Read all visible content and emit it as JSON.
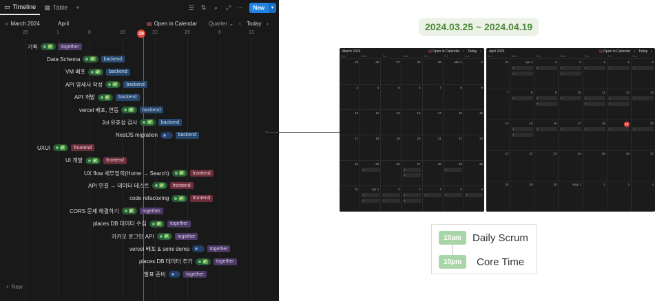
{
  "toolbar": {
    "tabs": [
      {
        "label": "Timeline",
        "icon": "timeline-icon"
      },
      {
        "label": "Table",
        "icon": "table-icon"
      }
    ],
    "add_view": "+",
    "new_label": "New"
  },
  "nav": {
    "month1": "March 2024",
    "month2": "April",
    "open_calendar": "Open in Calendar",
    "scale": "Quarter",
    "today": "Today"
  },
  "dates": [
    "25",
    "1",
    "8",
    "15",
    "19",
    "22",
    "29",
    "6",
    "13"
  ],
  "tasks": [
    {
      "name": "기획",
      "status": "done",
      "tag": "together"
    },
    {
      "name": "Data Schema",
      "status": "done",
      "tag": "backend"
    },
    {
      "name": "VM 배포",
      "status": "done",
      "tag": "backend"
    },
    {
      "name": "API 명세서 작성",
      "status": "done",
      "tag": "backend"
    },
    {
      "name": "API 개발",
      "status": "done",
      "tag": "backend"
    },
    {
      "name": "vercel 배포, 연동",
      "status": "done",
      "tag": "backend"
    },
    {
      "name": "Joi 유효성 검사",
      "status": "done",
      "tag": "backend"
    },
    {
      "name": "NestJS migration",
      "status": "prog",
      "tag": "backend"
    },
    {
      "name": "UXUI",
      "status": "done",
      "tag": "frontend"
    },
    {
      "name": "UI 개발",
      "status": "done",
      "tag": "frontend"
    },
    {
      "name": "UX flow 세부정의(Home → Search)",
      "status": "done",
      "tag": "frontend"
    },
    {
      "name": "API 연결 → 데이터 테스트",
      "status": "done",
      "tag": "frontend"
    },
    {
      "name": "code refactoring",
      "status": "done",
      "tag": "frontend"
    },
    {
      "name": "CORS 문제 해결하기",
      "status": "done",
      "tag": "together"
    },
    {
      "name": "places DB 데이터 수집",
      "status": "done",
      "tag": "together"
    },
    {
      "name": "카카오 로그인 API",
      "status": "done",
      "tag": "together"
    },
    {
      "name": "vercel 배포 & semi demo",
      "status": "prog",
      "tag": "together"
    },
    {
      "name": "places DB 데이터 추가",
      "status": "done",
      "tag": "together"
    },
    {
      "name": "발표 준비",
      "status": "prog",
      "tag": "together"
    }
  ],
  "status_glyph": {
    "done": "✅",
    "prog": "◌"
  },
  "new_row": "New",
  "range": "2024.03.25 ~ 2024.04.19",
  "march_cal": {
    "title": "March 2024",
    "open": "Open in Calendar",
    "today": "Today",
    "weekdays": [
      "Sun",
      "Mon",
      "Tue",
      "Wed",
      "Thu",
      "Fri",
      "Sat"
    ],
    "weeks": [
      [
        "25",
        "26",
        "27",
        "28",
        "29",
        "Mar 1",
        "2"
      ],
      [
        "3",
        "4",
        "5",
        "6",
        "7",
        "8",
        "9"
      ],
      [
        "10",
        "11",
        "12",
        "13",
        "14",
        "15",
        "16"
      ],
      [
        "17",
        "18",
        "19",
        "20",
        "21",
        "22",
        "23"
      ],
      [
        "24",
        "25",
        "26",
        "27",
        "28",
        "29",
        "30"
      ],
      [
        "31",
        "Apr 1",
        "2",
        "3",
        "4",
        "5",
        "6"
      ]
    ]
  },
  "april_cal": {
    "title": "April 2024",
    "open": "Open in Calendar",
    "today": "Today",
    "weekdays": [
      "Sun",
      "Mon",
      "Tue",
      "Wed",
      "Thu",
      "Fri",
      "Sat"
    ],
    "weeks": [
      [
        "31",
        "Apr 1",
        "2",
        "3",
        "4",
        "5",
        "6"
      ],
      [
        "7",
        "8",
        "9",
        "10",
        "11",
        "12",
        "13"
      ],
      [
        "14",
        "15",
        "16",
        "17",
        "18",
        "19",
        "20"
      ],
      [
        "21",
        "22",
        "23",
        "24",
        "25",
        "26",
        "27"
      ],
      [
        "28",
        "29",
        "30",
        "May 1",
        "2",
        "3",
        "4"
      ]
    ]
  },
  "legend": [
    {
      "time": "10am",
      "label": "Daily Scrum"
    },
    {
      "time": "10pm",
      "label": "Core Time"
    }
  ]
}
